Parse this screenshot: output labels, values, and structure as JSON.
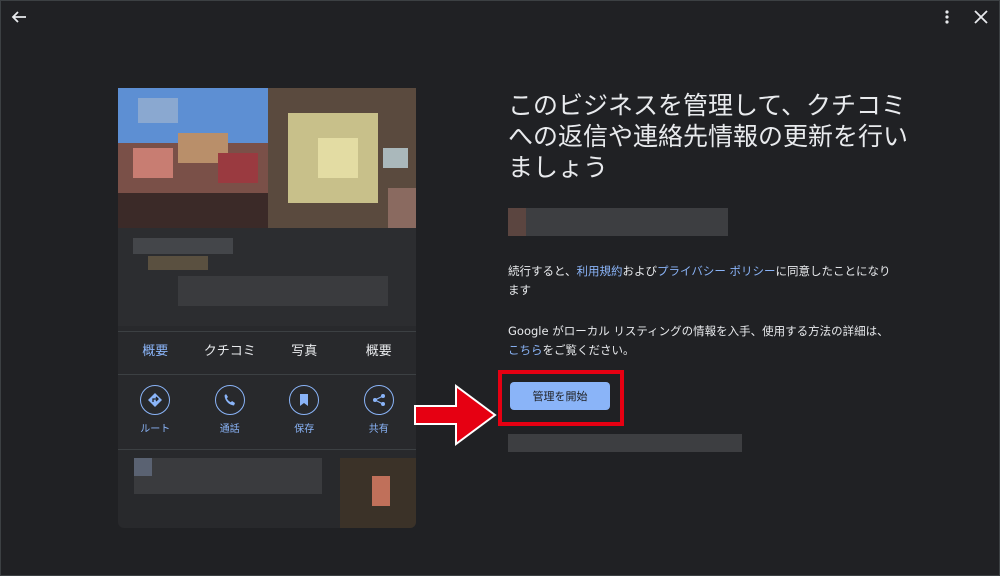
{
  "toolbar": {
    "back_icon": "arrow-left-icon",
    "more_icon": "more-vert-icon",
    "close_icon": "close-icon"
  },
  "preview": {
    "tabs": [
      {
        "label": "概要",
        "active": true
      },
      {
        "label": "クチコミ",
        "active": false
      },
      {
        "label": "写真",
        "active": false
      },
      {
        "label": "概要",
        "active": false
      }
    ],
    "actions": [
      {
        "label": "ルート",
        "icon": "directions-icon"
      },
      {
        "label": "通話",
        "icon": "phone-icon"
      },
      {
        "label": "保存",
        "icon": "bookmark-icon"
      },
      {
        "label": "共有",
        "icon": "share-icon"
      }
    ]
  },
  "main": {
    "heading": "このビジネスを管理して、クチコミへの返信や連絡先情報の更新を行いましょう",
    "terms": {
      "prefix": "続行すると、",
      "terms_link": "利用規約",
      "middle": "および",
      "privacy_link": "プライバシー ポリシー",
      "suffix": "に同意したことになります"
    },
    "info": {
      "prefix": "Google がローカル リスティングの情報を入手、使用する方法の詳細は、",
      "link": "こちら",
      "suffix": "をご覧ください。"
    },
    "start_button": "管理を開始"
  },
  "colors": {
    "background": "#202124",
    "accent": "#8ab4f8",
    "highlight": "#e60012"
  }
}
